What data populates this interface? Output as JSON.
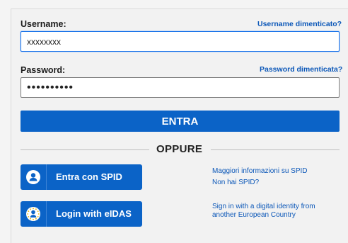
{
  "form": {
    "username_label": "Username:",
    "username_forgot": "Username dimenticato?",
    "username_value": "xxxxxxxx",
    "password_label": "Password:",
    "password_forgot": "Password dimenticata?",
    "password_value": "••••••••••",
    "submit_label": "ENTRA"
  },
  "divider": {
    "label": "OPPURE"
  },
  "spid": {
    "button_label": "Entra con SPID",
    "info_link": "Maggiori informazioni su SPID",
    "no_spid_link": "Non hai SPID?"
  },
  "eidas": {
    "button_label": "Login with eIDAS",
    "info_link_line1": "Sign in with a digital identity from",
    "info_link_line2": "another European Country"
  },
  "colors": {
    "primary": "#0b63c7",
    "link": "#0b57b8",
    "focus": "#1a73e8"
  },
  "icons": [
    "user-icon",
    "eu-stars-icon"
  ]
}
